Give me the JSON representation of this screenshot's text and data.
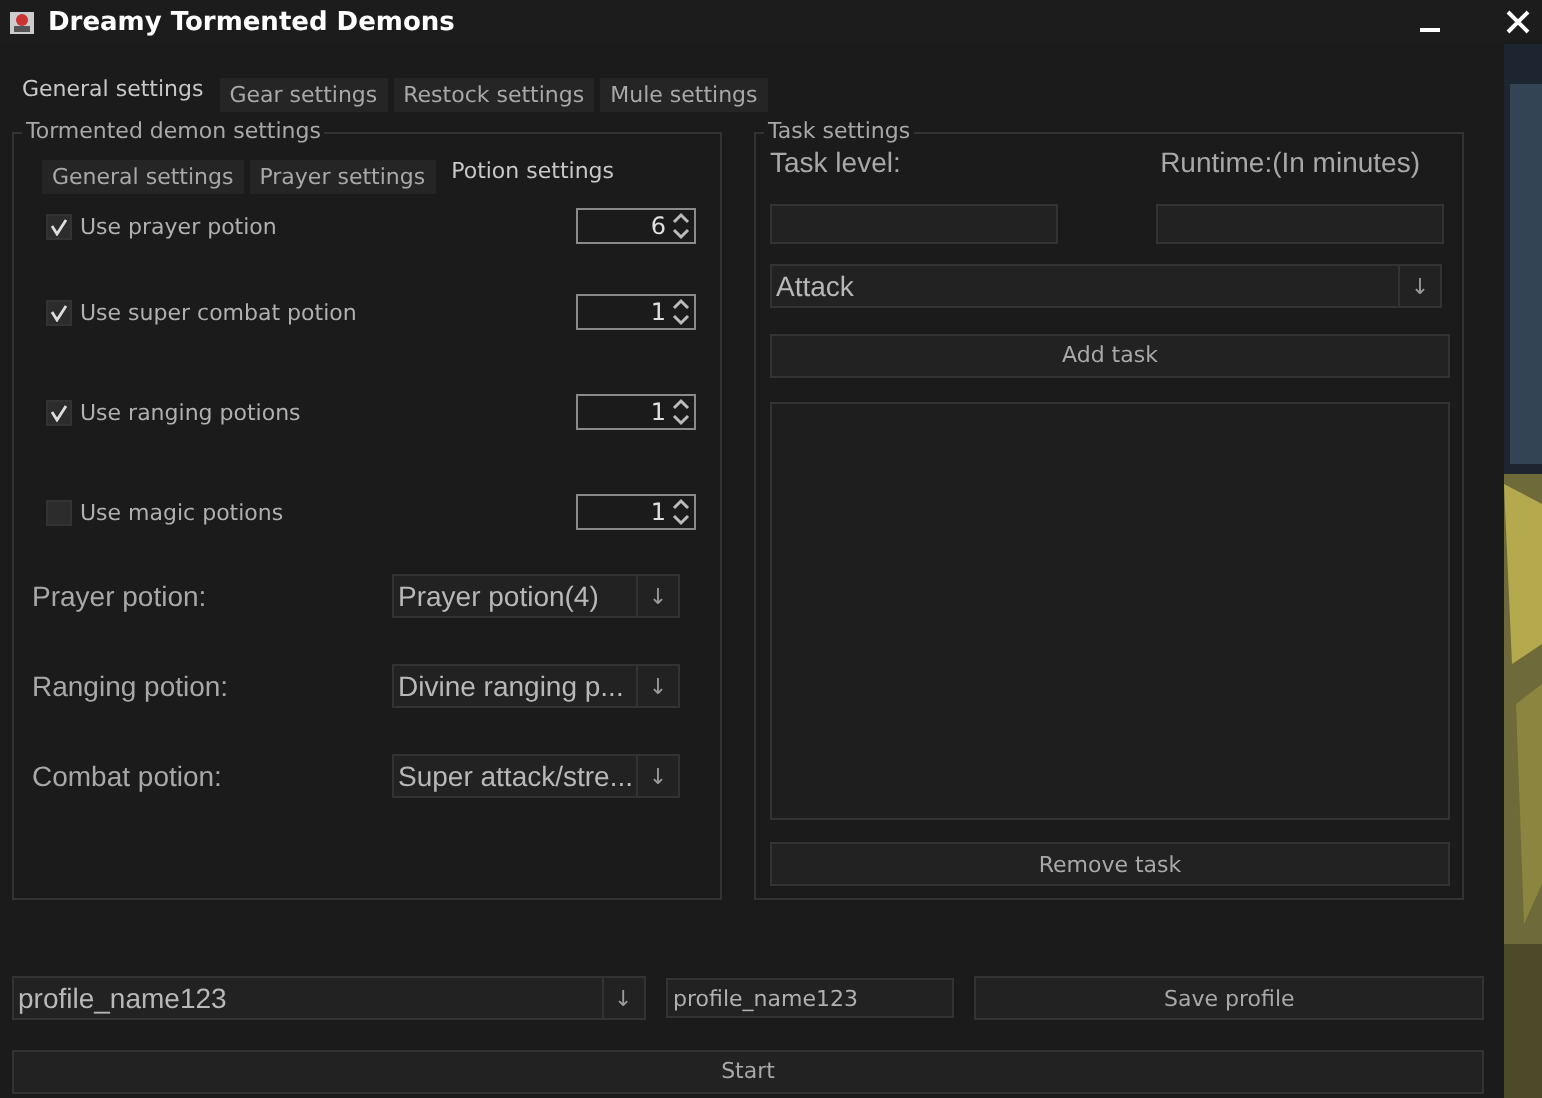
{
  "window": {
    "title": "Dreamy Tormented Demons"
  },
  "top_tabs": [
    {
      "label": "General settings",
      "selected": true
    },
    {
      "label": "Gear settings",
      "selected": false
    },
    {
      "label": "Restock settings",
      "selected": false
    },
    {
      "label": "Mule settings",
      "selected": false
    }
  ],
  "demon_settings": {
    "title": "Tormented demon settings",
    "tabs": [
      {
        "label": "General settings",
        "selected": false
      },
      {
        "label": "Prayer settings",
        "selected": false
      },
      {
        "label": "Potion settings",
        "selected": true
      }
    ],
    "potion_options": [
      {
        "label": "Use prayer potion",
        "checked": true,
        "quantity": "6"
      },
      {
        "label": "Use super combat potion",
        "checked": true,
        "quantity": "1"
      },
      {
        "label": "Use ranging potions",
        "checked": true,
        "quantity": "1"
      },
      {
        "label": "Use magic potions",
        "checked": false,
        "quantity": "1"
      }
    ],
    "potion_selects": [
      {
        "label": "Prayer potion:",
        "value": "Prayer potion(4)",
        "arrow": "↓"
      },
      {
        "label": "Ranging potion:",
        "value": "Divine ranging p...",
        "arrow": "↓"
      },
      {
        "label": "Combat potion:",
        "value": "Super attack/stre...",
        "arrow": "↓"
      }
    ]
  },
  "task_settings": {
    "title": "Task settings",
    "task_level_label": "Task level:",
    "runtime_label": "Runtime:(In minutes)",
    "skill_select": {
      "value": "Attack",
      "arrow": "↓"
    },
    "add_button": "Add task",
    "remove_button": "Remove task"
  },
  "profile": {
    "select_value": "profile_name123",
    "select_arrow": "↓",
    "name_value": "profile_name123",
    "save_button": "Save profile"
  },
  "start_button": "Start"
}
